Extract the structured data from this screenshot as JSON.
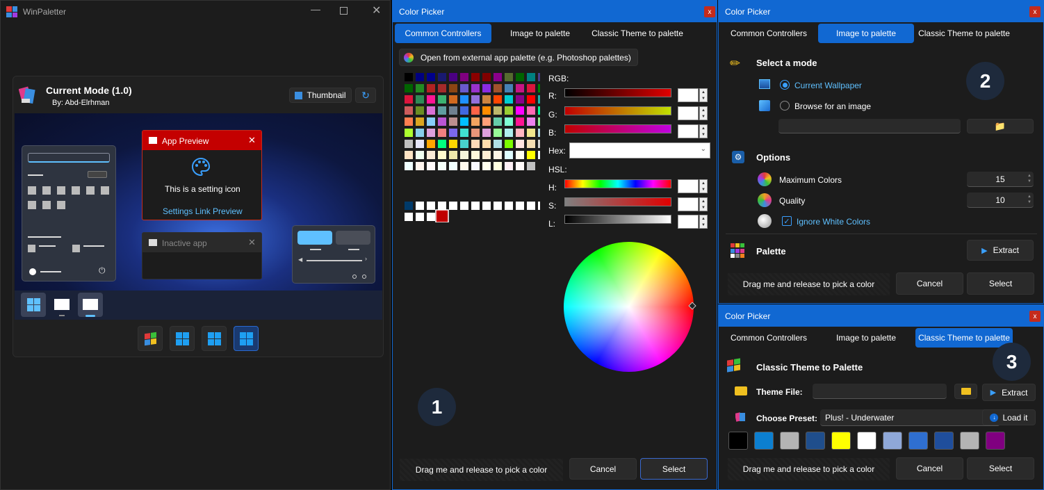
{
  "main": {
    "title": "WinPaletter",
    "theme_name": "Current Mode (1.0)",
    "author": "By: Abd-Elrhman",
    "thumbnail_label": "Thumbnail",
    "app_preview": {
      "title": "App Preview",
      "setting_text": "This is a setting icon",
      "link_text": "Settings Link Preview"
    },
    "inactive_title": "Inactive app"
  },
  "picker1": {
    "title": "Color Picker",
    "close": "x",
    "tabs": [
      "Common Controllers",
      "Image to palette",
      "Classic Theme to palette"
    ],
    "open_external": "Open from external app palette (e.g. Photoshop palettes)",
    "rgb_label": "RGB:",
    "r_label": "R:",
    "g_label": "G:",
    "b_label": "B:",
    "hex_label": "Hex:",
    "hsl_label": "HSL:",
    "h_label": "H:",
    "s_label": "S:",
    "l_label": "L:",
    "badge": "1",
    "drag_label": "Drag me and release to pick a color",
    "cancel": "Cancel",
    "select": "Select"
  },
  "picker2": {
    "title": "Color Picker",
    "close": "x",
    "tabs": [
      "Common Controllers",
      "Image to palette",
      "Classic Theme to palette"
    ],
    "select_mode": "Select a mode",
    "current_wallpaper": "Current Wallpaper",
    "browse_image": "Browse for an image",
    "options": "Options",
    "max_colors_label": "Maximum Colors",
    "max_colors": "15",
    "quality_label": "Quality",
    "quality": "10",
    "ignore_white": "Ignore White Colors",
    "palette": "Palette",
    "extract": "Extract",
    "badge": "2",
    "drag_label": "Drag me and release to pick a color",
    "cancel": "Cancel",
    "select": "Select"
  },
  "picker3": {
    "title": "Color Picker",
    "close": "x",
    "tabs": [
      "Common Controllers",
      "Image to palette",
      "Classic Theme to palette"
    ],
    "heading": "Classic Theme to Palette",
    "theme_file": "Theme File:",
    "extract": "Extract",
    "choose_preset": "Choose Preset:",
    "preset_value": "Plus! - Underwater",
    "load_it": "Load it",
    "badge": "3",
    "swatches": [
      "#000000",
      "#0c7fd0",
      "#b4b4b4",
      "#1f4e8c",
      "#ffff00",
      "#ffffff",
      "#8fa8d8",
      "#2f6fd0",
      "#1f4e9c",
      "#b4b4b4",
      "#800080"
    ],
    "drag_label": "Drag me and release to pick a color",
    "cancel": "Cancel",
    "select": "Select"
  },
  "colors": {
    "accent": "#1168d2",
    "close_red": "#c42b1c",
    "selected_color": "#c00000"
  }
}
